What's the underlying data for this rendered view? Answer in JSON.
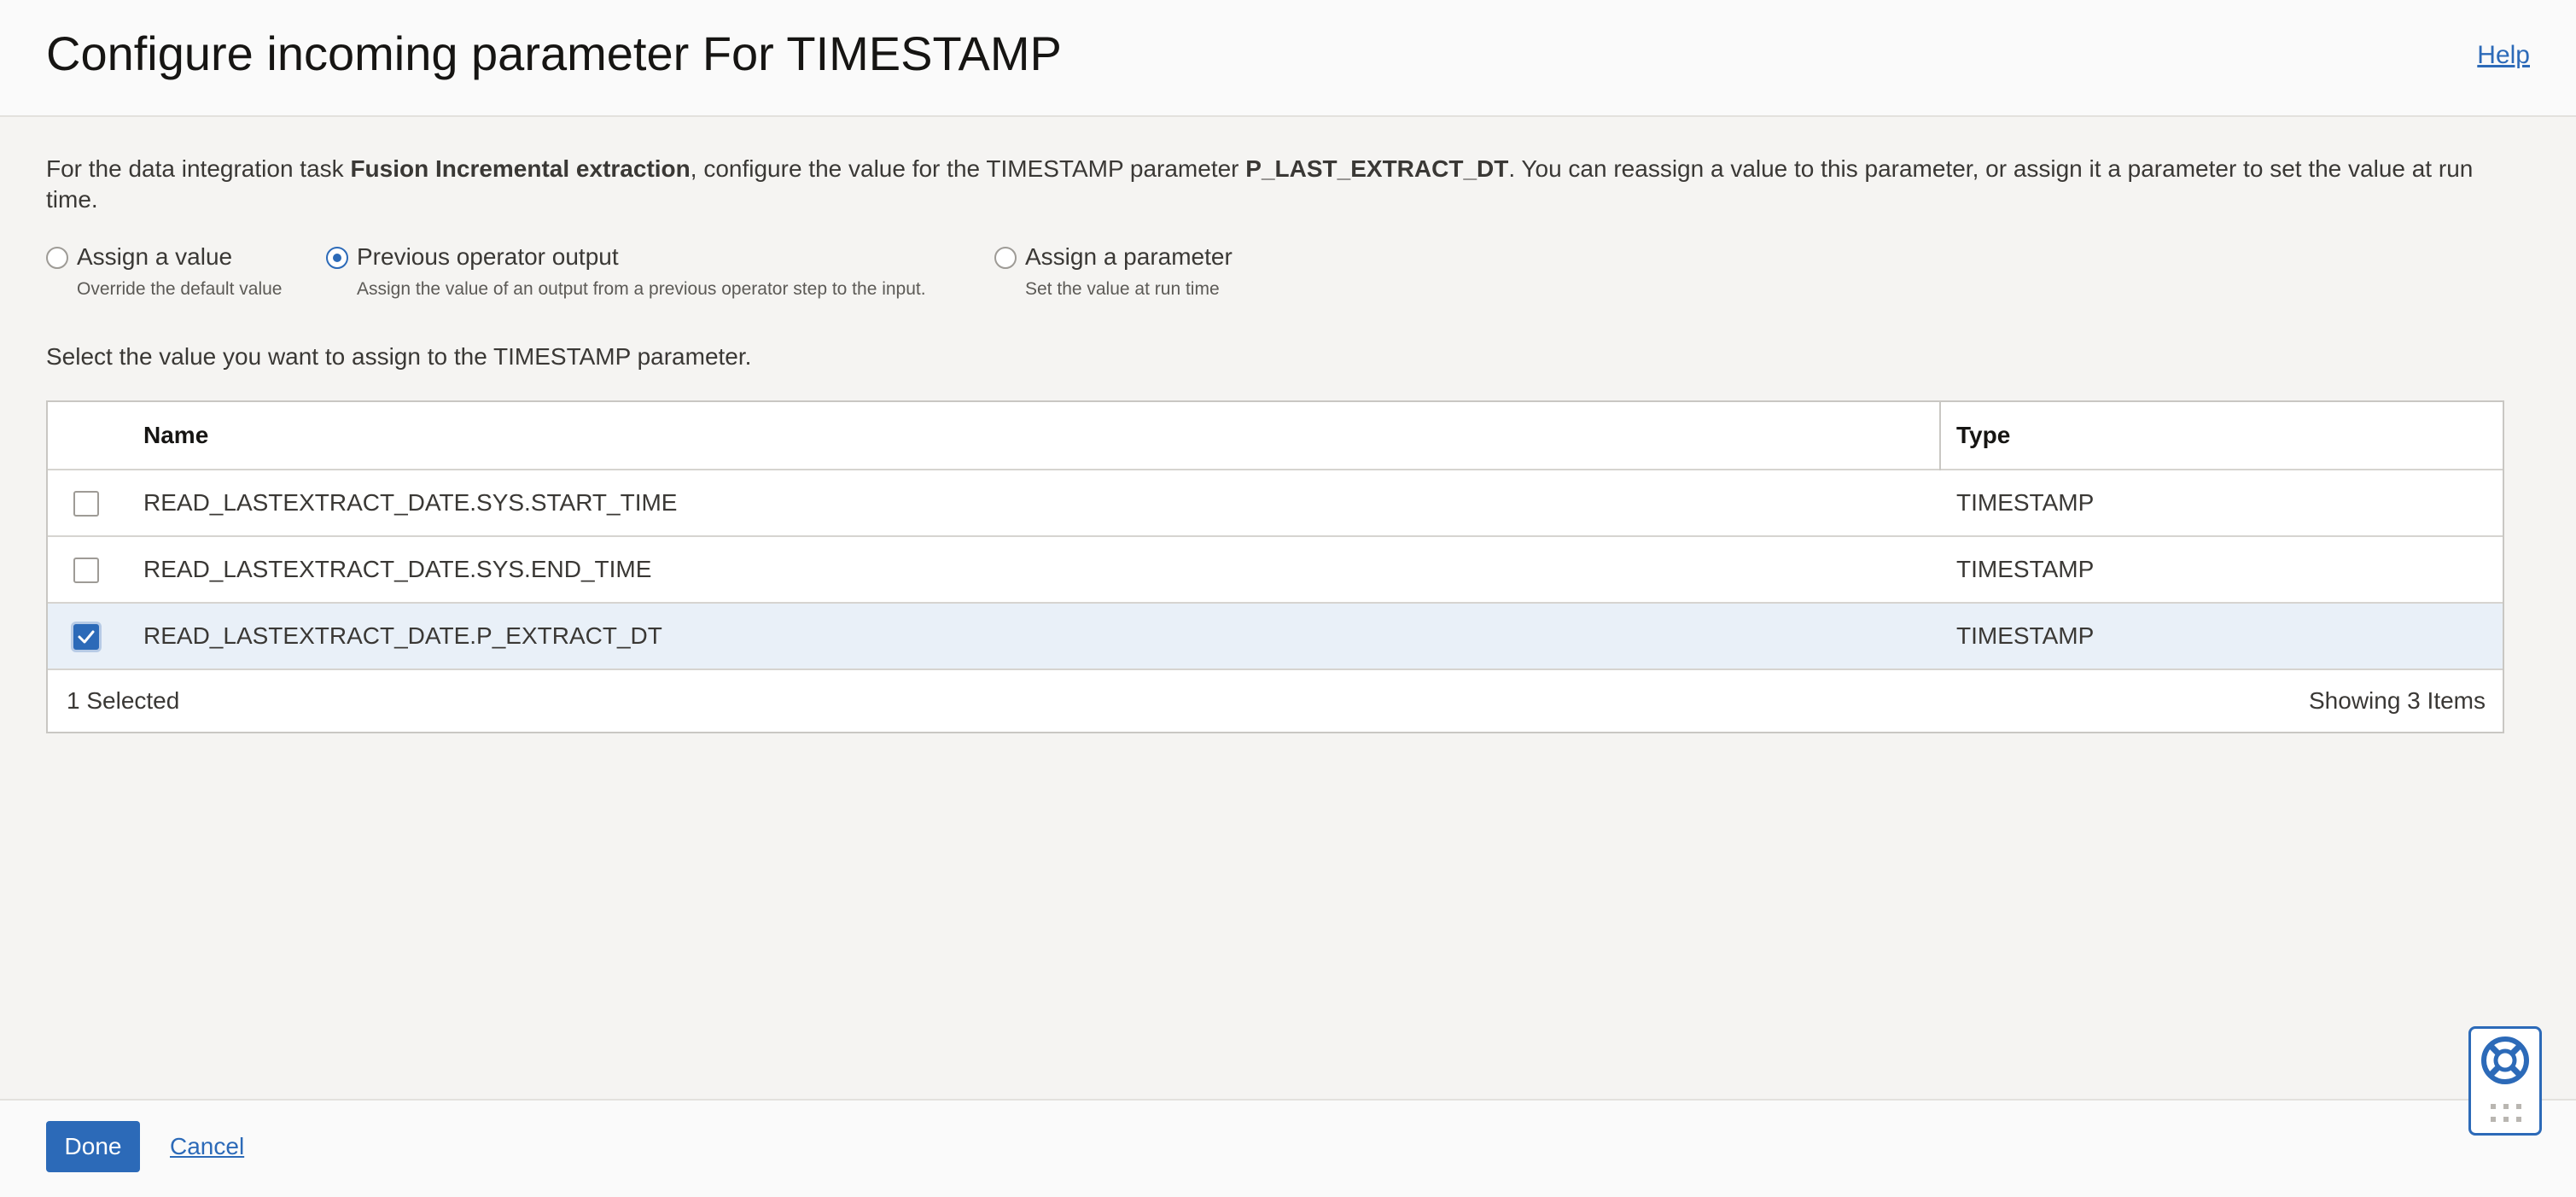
{
  "header": {
    "title": "Configure incoming parameter For TIMESTAMP",
    "help_label": "Help"
  },
  "description": {
    "prefix": "For the data integration task ",
    "task_name": "Fusion Incremental extraction",
    "middle": ", configure the value for the TIMESTAMP parameter ",
    "parameter_name": "P_LAST_EXTRACT_DT",
    "suffix": ". You can reassign a value to this parameter, or assign it a parameter to set the value at run time."
  },
  "options": [
    {
      "label": "Assign a value",
      "sublabel": "Override the default value",
      "selected": false
    },
    {
      "label": "Previous operator output",
      "sublabel": "Assign the value of an output from a previous operator step to the input.",
      "selected": true
    },
    {
      "label": "Assign a parameter",
      "sublabel": "Set the value at run time",
      "selected": false
    }
  ],
  "prompt": "Select the value you want to assign to the TIMESTAMP parameter.",
  "table": {
    "headers": {
      "name": "Name",
      "type": "Type"
    },
    "rows": [
      {
        "name": "READ_LASTEXTRACT_DATE.SYS.START_TIME",
        "type": "TIMESTAMP",
        "checked": false
      },
      {
        "name": "READ_LASTEXTRACT_DATE.SYS.END_TIME",
        "type": "TIMESTAMP",
        "checked": false
      },
      {
        "name": "READ_LASTEXTRACT_DATE.P_EXTRACT_DT",
        "type": "TIMESTAMP",
        "checked": true
      }
    ],
    "selected_count": "1 Selected",
    "showing_count": "Showing 3 Items"
  },
  "footer": {
    "done_label": "Done",
    "cancel_label": "Cancel"
  },
  "colors": {
    "accent": "#2c6ab8",
    "selected_row": "#e9f0f8",
    "background": "#f5f4f2"
  },
  "icons": {
    "help_widget": "lifebuoy-icon",
    "checkmark": "checkmark-icon"
  }
}
